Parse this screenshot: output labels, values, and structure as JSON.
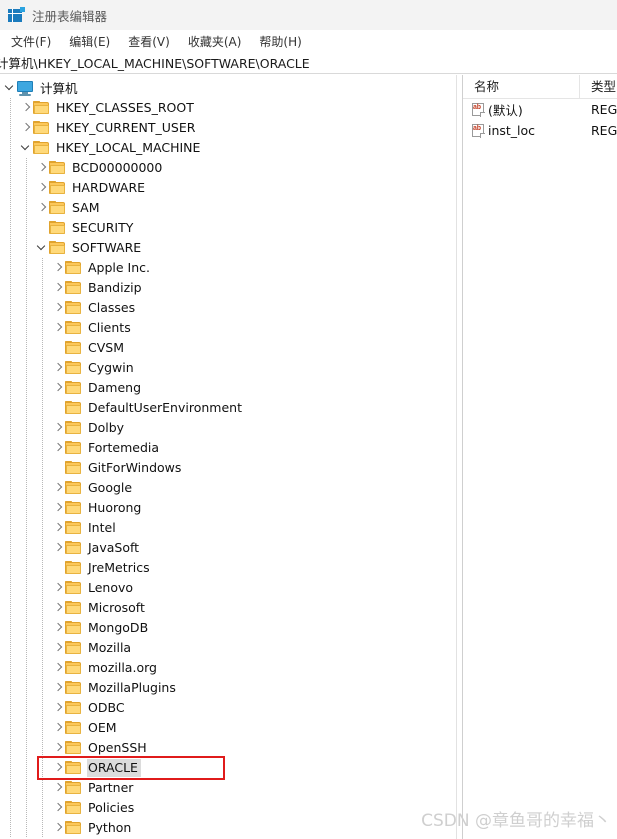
{
  "window": {
    "title": "注册表编辑器",
    "icon": "registry-editor-icon"
  },
  "menubar": {
    "items": [
      {
        "label": "文件(F)"
      },
      {
        "label": "编辑(E)"
      },
      {
        "label": "查看(V)"
      },
      {
        "label": "收藏夹(A)"
      },
      {
        "label": "帮助(H)"
      }
    ]
  },
  "address": {
    "path": "计算机\\HKEY_LOCAL_MACHINE\\SOFTWARE\\ORACLE"
  },
  "tree": {
    "items": [
      {
        "label": "计算机",
        "depth": 0,
        "icon": "computer-icon",
        "expander": "open",
        "selected": false
      },
      {
        "label": "HKEY_CLASSES_ROOT",
        "depth": 1,
        "icon": "folder-icon",
        "expander": "collapsed",
        "selected": false
      },
      {
        "label": "HKEY_CURRENT_USER",
        "depth": 1,
        "icon": "folder-icon",
        "expander": "collapsed",
        "selected": false
      },
      {
        "label": "HKEY_LOCAL_MACHINE",
        "depth": 1,
        "icon": "folder-icon",
        "expander": "open",
        "selected": false
      },
      {
        "label": "BCD00000000",
        "depth": 2,
        "icon": "folder-icon",
        "expander": "collapsed",
        "selected": false
      },
      {
        "label": "HARDWARE",
        "depth": 2,
        "icon": "folder-icon",
        "expander": "collapsed",
        "selected": false
      },
      {
        "label": "SAM",
        "depth": 2,
        "icon": "folder-icon",
        "expander": "collapsed",
        "selected": false
      },
      {
        "label": "SECURITY",
        "depth": 2,
        "icon": "folder-icon",
        "expander": "none",
        "selected": false
      },
      {
        "label": "SOFTWARE",
        "depth": 2,
        "icon": "folder-icon",
        "expander": "open",
        "selected": false
      },
      {
        "label": "Apple Inc.",
        "depth": 3,
        "icon": "folder-icon",
        "expander": "collapsed",
        "selected": false
      },
      {
        "label": "Bandizip",
        "depth": 3,
        "icon": "folder-icon",
        "expander": "collapsed",
        "selected": false
      },
      {
        "label": "Classes",
        "depth": 3,
        "icon": "folder-icon",
        "expander": "collapsed",
        "selected": false
      },
      {
        "label": "Clients",
        "depth": 3,
        "icon": "folder-icon",
        "expander": "collapsed",
        "selected": false
      },
      {
        "label": "CVSM",
        "depth": 3,
        "icon": "folder-icon",
        "expander": "none",
        "selected": false
      },
      {
        "label": "Cygwin",
        "depth": 3,
        "icon": "folder-icon",
        "expander": "collapsed",
        "selected": false
      },
      {
        "label": "Dameng",
        "depth": 3,
        "icon": "folder-icon",
        "expander": "collapsed",
        "selected": false
      },
      {
        "label": "DefaultUserEnvironment",
        "depth": 3,
        "icon": "folder-icon",
        "expander": "none",
        "selected": false
      },
      {
        "label": "Dolby",
        "depth": 3,
        "icon": "folder-icon",
        "expander": "collapsed",
        "selected": false
      },
      {
        "label": "Fortemedia",
        "depth": 3,
        "icon": "folder-icon",
        "expander": "collapsed",
        "selected": false
      },
      {
        "label": "GitForWindows",
        "depth": 3,
        "icon": "folder-icon",
        "expander": "none",
        "selected": false
      },
      {
        "label": "Google",
        "depth": 3,
        "icon": "folder-icon",
        "expander": "collapsed",
        "selected": false
      },
      {
        "label": "Huorong",
        "depth": 3,
        "icon": "folder-icon",
        "expander": "collapsed",
        "selected": false
      },
      {
        "label": "Intel",
        "depth": 3,
        "icon": "folder-icon",
        "expander": "collapsed",
        "selected": false
      },
      {
        "label": "JavaSoft",
        "depth": 3,
        "icon": "folder-icon",
        "expander": "collapsed",
        "selected": false
      },
      {
        "label": "JreMetrics",
        "depth": 3,
        "icon": "folder-icon",
        "expander": "none",
        "selected": false
      },
      {
        "label": "Lenovo",
        "depth": 3,
        "icon": "folder-icon",
        "expander": "collapsed",
        "selected": false
      },
      {
        "label": "Microsoft",
        "depth": 3,
        "icon": "folder-icon",
        "expander": "collapsed",
        "selected": false
      },
      {
        "label": "MongoDB",
        "depth": 3,
        "icon": "folder-icon",
        "expander": "collapsed",
        "selected": false
      },
      {
        "label": "Mozilla",
        "depth": 3,
        "icon": "folder-icon",
        "expander": "collapsed",
        "selected": false
      },
      {
        "label": "mozilla.org",
        "depth": 3,
        "icon": "folder-icon",
        "expander": "collapsed",
        "selected": false
      },
      {
        "label": "MozillaPlugins",
        "depth": 3,
        "icon": "folder-icon",
        "expander": "collapsed",
        "selected": false
      },
      {
        "label": "ODBC",
        "depth": 3,
        "icon": "folder-icon",
        "expander": "collapsed",
        "selected": false
      },
      {
        "label": "OEM",
        "depth": 3,
        "icon": "folder-icon",
        "expander": "collapsed",
        "selected": false
      },
      {
        "label": "OpenSSH",
        "depth": 3,
        "icon": "folder-icon",
        "expander": "collapsed",
        "selected": false
      },
      {
        "label": "ORACLE",
        "depth": 3,
        "icon": "folder-icon",
        "expander": "collapsed",
        "selected": true
      },
      {
        "label": "Partner",
        "depth": 3,
        "icon": "folder-icon",
        "expander": "collapsed",
        "selected": false
      },
      {
        "label": "Policies",
        "depth": 3,
        "icon": "folder-icon",
        "expander": "collapsed",
        "selected": false
      },
      {
        "label": "Python",
        "depth": 3,
        "icon": "folder-icon",
        "expander": "collapsed",
        "selected": false
      }
    ]
  },
  "values": {
    "columns": [
      "名称",
      "类型"
    ],
    "rows": [
      {
        "icon": "string-value-icon",
        "name": "(默认)",
        "type": "REG_"
      },
      {
        "icon": "string-value-icon",
        "name": "inst_loc",
        "type": "REG_"
      }
    ]
  },
  "annotation": {
    "color": "#e01b1b",
    "target": "ORACLE"
  },
  "watermark": {
    "text": "CSDN @章鱼哥的幸福丶"
  }
}
